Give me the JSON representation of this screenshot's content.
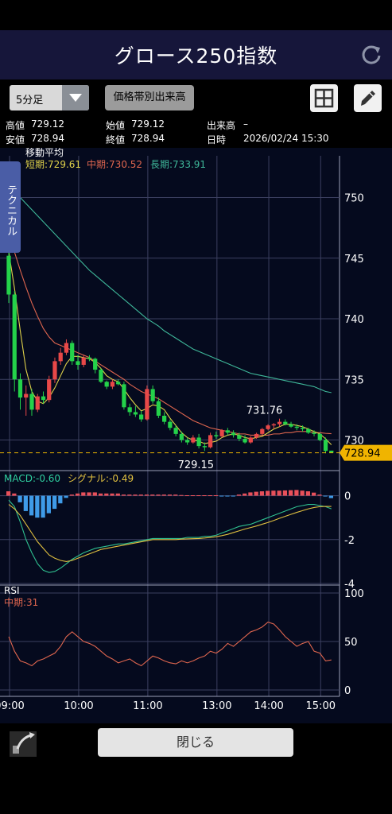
{
  "header": {
    "title": "グロース250指数"
  },
  "toolbar": {
    "interval": "5分足",
    "volume_button": "価格帯別出来高"
  },
  "info": {
    "high_label": "高値",
    "high": "729.12",
    "open_label": "始値",
    "open": "729.12",
    "volume_label": "出来高",
    "volume": "–",
    "low_label": "安値",
    "low": "728.94",
    "close_label": "終値",
    "close": "728.94",
    "datetime_label": "日時",
    "datetime": "2026/02/24 15:30"
  },
  "side_tab": {
    "label": "テクニカル"
  },
  "bottom": {
    "close_label": "閉じる"
  },
  "chart_data": {
    "type": "candlestick",
    "x_ticks": [
      "09:00",
      "10:00",
      "11:00",
      "13:00",
      "14:00",
      "15:00"
    ],
    "price": {
      "ylim": [
        728,
        752
      ],
      "y_ticks": [
        750,
        745,
        740,
        735,
        730
      ],
      "ma_title": "移動平均",
      "ma_legend": [
        {
          "label": "短期:729.61",
          "color": "#e0d24a"
        },
        {
          "label": "中期:730.52",
          "color": "#e0664f"
        },
        {
          "label": "長期:733.91",
          "color": "#3fb89a"
        }
      ],
      "annotations": {
        "high": "731.76",
        "low": "729.15",
        "last": "728.94"
      },
      "last_price": 728.94,
      "candles": [
        [
          745.2,
          745.5,
          741.3,
          742.0
        ],
        [
          742.0,
          742.3,
          734.0,
          735.0
        ],
        [
          735.0,
          735.5,
          732.5,
          733.5
        ],
        [
          733.5,
          734.5,
          732.0,
          733.8
        ],
        [
          733.8,
          734.2,
          732.0,
          732.5
        ],
        [
          732.5,
          733.8,
          732.3,
          733.6
        ],
        [
          733.6,
          734.0,
          733.0,
          733.3
        ],
        [
          733.3,
          735.3,
          733.1,
          735.0
        ],
        [
          735.0,
          736.8,
          734.7,
          736.5
        ],
        [
          736.5,
          737.6,
          736.2,
          737.2
        ],
        [
          737.2,
          738.3,
          737.0,
          738.0
        ],
        [
          738.0,
          738.2,
          736.2,
          736.5
        ],
        [
          736.5,
          737.0,
          735.8,
          736.2
        ],
        [
          736.2,
          737.0,
          736.0,
          736.8
        ],
        [
          736.8,
          737.0,
          736.5,
          736.7
        ],
        [
          736.7,
          736.8,
          735.5,
          735.8
        ],
        [
          735.8,
          735.9,
          734.7,
          734.8
        ],
        [
          734.8,
          734.9,
          734.2,
          734.4
        ],
        [
          734.4,
          735.0,
          734.2,
          734.8
        ],
        [
          734.8,
          735.0,
          734.5,
          734.6
        ],
        [
          734.6,
          734.8,
          732.5,
          732.7
        ],
        [
          732.7,
          733.0,
          732.0,
          732.3
        ],
        [
          732.3,
          732.8,
          731.9,
          732.1
        ],
        [
          732.1,
          732.4,
          731.5,
          731.7
        ],
        [
          731.7,
          734.5,
          731.6,
          734.2
        ],
        [
          734.2,
          734.5,
          733.0,
          733.2
        ],
        [
          733.2,
          733.5,
          731.8,
          732.0
        ],
        [
          732.0,
          732.3,
          731.3,
          731.5
        ],
        [
          731.5,
          731.7,
          730.8,
          731.0
        ],
        [
          731.0,
          731.2,
          730.3,
          730.5
        ],
        [
          730.5,
          730.7,
          729.8,
          730.0
        ],
        [
          730.0,
          730.2,
          729.6,
          729.8
        ],
        [
          729.8,
          730.4,
          729.7,
          730.2
        ],
        [
          730.2,
          730.5,
          729.3,
          729.5
        ],
        [
          729.5,
          729.8,
          729.1,
          729.4
        ],
        [
          729.4,
          730.6,
          729.3,
          730.4
        ],
        [
          730.4,
          730.7,
          730.1,
          730.3
        ],
        [
          730.3,
          730.9,
          730.2,
          730.8
        ],
        [
          730.8,
          731.0,
          730.4,
          730.6
        ],
        [
          730.6,
          730.8,
          730.2,
          730.4
        ],
        [
          730.4,
          730.6,
          729.9,
          730.1
        ],
        [
          730.1,
          730.4,
          729.7,
          729.8
        ],
        [
          729.8,
          730.3,
          729.7,
          730.2
        ],
        [
          730.2,
          730.6,
          730.1,
          730.5
        ],
        [
          730.5,
          731.0,
          730.4,
          730.9
        ],
        [
          730.9,
          731.3,
          730.8,
          731.2
        ],
        [
          731.2,
          731.4,
          730.9,
          731.3
        ],
        [
          731.3,
          731.76,
          731.1,
          731.5
        ],
        [
          731.5,
          731.7,
          731.2,
          731.3
        ],
        [
          731.3,
          731.5,
          731.0,
          731.1
        ],
        [
          731.1,
          731.3,
          730.8,
          731.0
        ],
        [
          731.0,
          731.2,
          730.7,
          730.9
        ],
        [
          730.9,
          731.0,
          730.5,
          730.6
        ],
        [
          730.6,
          730.8,
          730.3,
          730.5
        ],
        [
          730.5,
          730.6,
          729.9,
          730.0
        ],
        [
          730.0,
          730.2,
          728.9,
          729.1
        ],
        [
          729.12,
          729.12,
          728.94,
          728.94
        ]
      ],
      "ma_short": [
        745.5,
        742.5,
        739.0,
        735.8,
        734.0,
        733.2,
        733.0,
        733.5,
        734.3,
        735.3,
        736.3,
        736.9,
        736.9,
        736.8,
        736.7,
        736.4,
        735.9,
        735.3,
        735.0,
        734.8,
        734.2,
        733.5,
        732.9,
        732.4,
        732.6,
        732.9,
        732.8,
        732.5,
        731.8,
        731.2,
        730.6,
        730.2,
        730.0,
        729.9,
        729.7,
        729.8,
        729.9,
        730.2,
        730.4,
        730.5,
        730.4,
        730.2,
        730.1,
        730.2,
        730.3,
        730.6,
        730.9,
        731.1,
        731.3,
        731.3,
        731.2,
        731.1,
        730.9,
        730.7,
        730.5,
        730.1,
        729.61
      ],
      "ma_mid": [
        747.0,
        745.5,
        744.0,
        742.6,
        741.3,
        740.2,
        739.2,
        738.5,
        738.0,
        737.8,
        737.6,
        737.4,
        737.2,
        737.0,
        736.8,
        736.5,
        736.2,
        735.9,
        735.6,
        735.3,
        735.0,
        734.6,
        734.3,
        734.0,
        733.8,
        733.6,
        733.4,
        733.1,
        732.8,
        732.5,
        732.2,
        731.9,
        731.6,
        731.4,
        731.2,
        731.0,
        730.9,
        730.8,
        730.7,
        730.6,
        730.5,
        730.5,
        730.4,
        730.4,
        730.4,
        730.4,
        730.5,
        730.5,
        730.6,
        730.6,
        730.7,
        730.7,
        730.7,
        730.6,
        730.6,
        730.55,
        730.52
      ],
      "ma_long": [
        751.0,
        750.5,
        750.0,
        749.5,
        749.0,
        748.5,
        748.0,
        747.5,
        747.0,
        746.5,
        746.0,
        745.5,
        745.0,
        744.5,
        744.0,
        743.6,
        743.2,
        742.8,
        742.4,
        742.0,
        741.6,
        741.2,
        740.8,
        740.4,
        740.0,
        739.7,
        739.4,
        739.0,
        738.7,
        738.4,
        738.1,
        737.8,
        737.5,
        737.3,
        737.1,
        736.9,
        736.7,
        736.5,
        736.3,
        736.1,
        735.9,
        735.7,
        735.5,
        735.4,
        735.3,
        735.2,
        735.1,
        735.0,
        734.9,
        734.8,
        734.7,
        734.6,
        734.5,
        734.4,
        734.2,
        734.0,
        733.91
      ]
    },
    "macd": {
      "label": "MACD:-0.60",
      "signal_label": "シグナル:-0.49",
      "ylim": [
        -4,
        0.6
      ],
      "y_ticks": [
        0,
        -2,
        -4
      ],
      "macd_line": [
        -0.2,
        -0.5,
        -1.2,
        -2.0,
        -2.6,
        -3.1,
        -3.4,
        -3.5,
        -3.45,
        -3.3,
        -3.1,
        -2.9,
        -2.75,
        -2.6,
        -2.5,
        -2.4,
        -2.35,
        -2.3,
        -2.25,
        -2.2,
        -2.2,
        -2.15,
        -2.1,
        -2.05,
        -2.0,
        -1.95,
        -1.95,
        -1.95,
        -1.95,
        -1.95,
        -1.95,
        -1.9,
        -1.9,
        -1.9,
        -1.85,
        -1.85,
        -1.8,
        -1.7,
        -1.6,
        -1.5,
        -1.4,
        -1.35,
        -1.3,
        -1.2,
        -1.1,
        -1.0,
        -0.9,
        -0.8,
        -0.7,
        -0.6,
        -0.5,
        -0.45,
        -0.4,
        -0.4,
        -0.45,
        -0.5,
        -0.6
      ],
      "signal_line": [
        -0.4,
        -0.6,
        -0.9,
        -1.3,
        -1.7,
        -2.1,
        -2.4,
        -2.7,
        -2.85,
        -2.95,
        -3.0,
        -2.95,
        -2.85,
        -2.75,
        -2.65,
        -2.55,
        -2.45,
        -2.4,
        -2.35,
        -2.3,
        -2.25,
        -2.2,
        -2.15,
        -2.1,
        -2.05,
        -2.0,
        -2.0,
        -2.0,
        -2.0,
        -2.0,
        -1.98,
        -1.97,
        -1.96,
        -1.95,
        -1.93,
        -1.9,
        -1.87,
        -1.82,
        -1.76,
        -1.68,
        -1.6,
        -1.52,
        -1.45,
        -1.38,
        -1.3,
        -1.22,
        -1.13,
        -1.03,
        -0.94,
        -0.85,
        -0.76,
        -0.68,
        -0.6,
        -0.54,
        -0.5,
        -0.49,
        -0.49
      ],
      "histogram": [
        0.2,
        0.1,
        -0.3,
        -0.7,
        -0.9,
        -1.0,
        -1.0,
        -0.8,
        -0.6,
        -0.35,
        -0.1,
        0.05,
        0.1,
        0.15,
        0.15,
        0.15,
        0.1,
        0.1,
        0.1,
        0.1,
        0.05,
        0.05,
        0.05,
        0.05,
        0.05,
        0.05,
        0.05,
        0.05,
        0.05,
        0.05,
        0.03,
        0.02,
        0.02,
        0.02,
        0.02,
        0.02,
        0.02,
        -0.02,
        -0.03,
        -0.02,
        0.05,
        0.1,
        0.15,
        0.18,
        0.2,
        0.22,
        0.23,
        0.23,
        0.24,
        0.25,
        0.26,
        0.23,
        0.2,
        0.14,
        0.05,
        -0.01,
        -0.11
      ]
    },
    "rsi": {
      "label": "RSI",
      "period_label": "中期:31",
      "ylim": [
        0,
        100
      ],
      "y_ticks": [
        100,
        50,
        0
      ],
      "values": [
        55,
        40,
        30,
        28,
        25,
        30,
        32,
        35,
        38,
        45,
        55,
        60,
        55,
        50,
        48,
        45,
        40,
        35,
        32,
        28,
        30,
        32,
        28,
        25,
        30,
        35,
        33,
        30,
        28,
        27,
        30,
        28,
        30,
        33,
        35,
        40,
        38,
        42,
        48,
        45,
        50,
        55,
        60,
        62,
        65,
        70,
        68,
        62,
        55,
        50,
        45,
        48,
        50,
        40,
        38,
        30,
        31
      ]
    }
  }
}
